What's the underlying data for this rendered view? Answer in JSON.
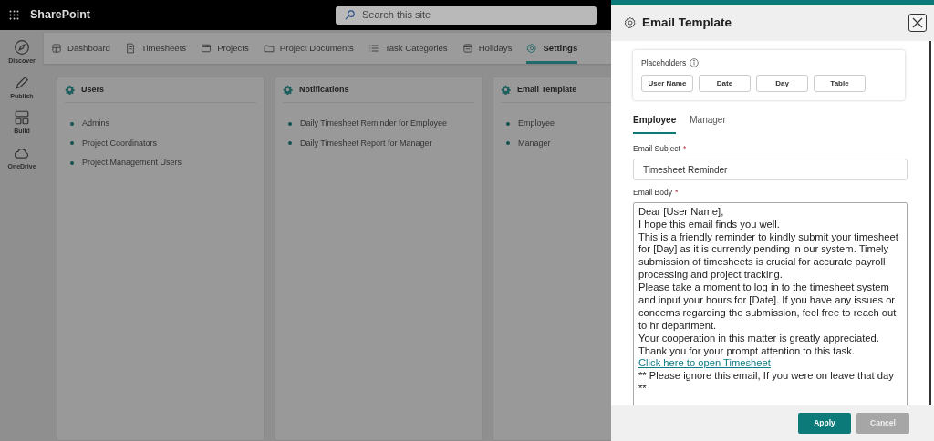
{
  "topbar": {
    "app_name": "SharePoint",
    "search": {
      "placeholder": "Search this site"
    }
  },
  "rail": [
    {
      "label": "Discover",
      "kind": "compass"
    },
    {
      "label": "Publish",
      "kind": "pen"
    },
    {
      "label": "Build",
      "kind": "blocks"
    },
    {
      "label": "OneDrive",
      "kind": "cloud"
    }
  ],
  "nav_tabs": [
    {
      "label": "Dashboard",
      "kind": "dashboard",
      "selected": false
    },
    {
      "label": "Timesheets",
      "kind": "sheet",
      "selected": false
    },
    {
      "label": "Projects",
      "kind": "projects",
      "selected": false
    },
    {
      "label": "Project Documents",
      "kind": "folder",
      "selected": false
    },
    {
      "label": "Task Categories",
      "kind": "list",
      "selected": false
    },
    {
      "label": "Holidays",
      "kind": "calendar",
      "selected": false
    },
    {
      "label": "Settings",
      "kind": "gear",
      "selected": true
    }
  ],
  "cards": [
    {
      "title": "Users",
      "items": [
        "Admins",
        "Project Coordinators",
        "Project Management Users"
      ]
    },
    {
      "title": "Notifications",
      "items": [
        "Daily Timesheet Reminder for Employee",
        "Daily Timesheet Report for Manager"
      ]
    },
    {
      "title": "Email Template",
      "items": [
        "Employee",
        "Manager"
      ]
    }
  ],
  "panel": {
    "title": "Email Template",
    "placeholders": {
      "label": "Placeholders",
      "buttons": [
        "User Name",
        "Date",
        "Day",
        "Table"
      ]
    },
    "tabs": [
      {
        "label": "Employee",
        "selected": true
      },
      {
        "label": "Manager",
        "selected": false
      }
    ],
    "subject": {
      "label": "Email Subject",
      "required_mark": "*",
      "value": "Timesheet Reminder"
    },
    "body": {
      "label": "Email Body",
      "required_mark": "*",
      "paragraphs": [
        {
          "kind": "text",
          "text": "Dear [User Name],"
        },
        {
          "kind": "text",
          "text": "I hope this email finds you well."
        },
        {
          "kind": "text",
          "text": "This is a friendly reminder to kindly submit your timesheet for [Day] as it is currently pending in our system. Timely submission of timesheets is crucial for accurate payroll processing and project tracking."
        },
        {
          "kind": "text",
          "text": "Please take a moment to log in to the timesheet system and input your hours for [Date]. If you have any issues or concerns regarding the submission, feel free to reach out to hr department."
        },
        {
          "kind": "text",
          "text": "Your cooperation in this matter is greatly appreciated. Thank you for your prompt attention to this task."
        },
        {
          "kind": "link",
          "text": "Click here to open Timesheet"
        },
        {
          "kind": "text",
          "text": "** Please ignore this email, If you were on leave that day **"
        }
      ]
    },
    "buttons": [
      {
        "label": "Apply",
        "kind": "primary"
      },
      {
        "label": "Cancel",
        "kind": "secondary"
      }
    ]
  }
}
